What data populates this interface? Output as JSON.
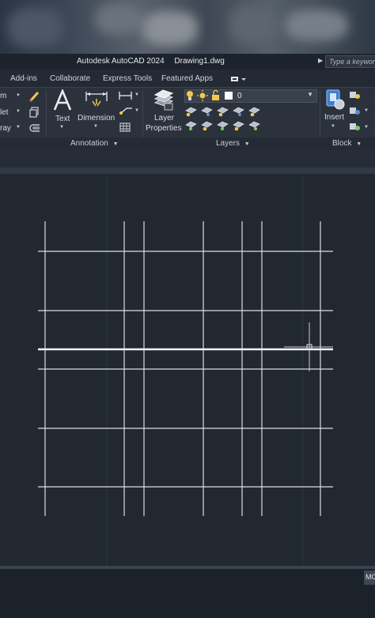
{
  "window": {
    "app_title": "Autodesk AutoCAD 2024",
    "document_title": "Drawing1.dwg",
    "search_placeholder": "Type a keyword"
  },
  "ribbon_tabs": [
    "Add-ins",
    "Collaborate",
    "Express Tools",
    "Featured Apps"
  ],
  "modify_panel": {
    "items": [
      "m",
      "let",
      "ray"
    ]
  },
  "annotation_panel": {
    "title": "Annotation",
    "text_label": "Text",
    "dimension_label": "Dimension"
  },
  "layers_panel": {
    "title": "Layers",
    "layer_properties_line1": "Layer",
    "layer_properties_line2": "Properties",
    "current_layer": "0"
  },
  "block_panel": {
    "title": "Block",
    "insert_label": "Insert"
  },
  "status": {
    "model_tab": "MODEL"
  },
  "colors": {
    "canvas_background": "#212830",
    "ribbon_background": "#2b323c",
    "grid_line": "#d9dde3",
    "accent_yellow": "#f2c94c"
  },
  "icons": [
    "pencil-icon",
    "text-a-icon",
    "dimension-icon",
    "linear-dim-icon",
    "leader-icon",
    "table-icon",
    "layer-properties-icon",
    "lightbulb-icon",
    "sun-icon",
    "lock-icon",
    "insert-block-icon",
    "crosshair-cursor"
  ]
}
